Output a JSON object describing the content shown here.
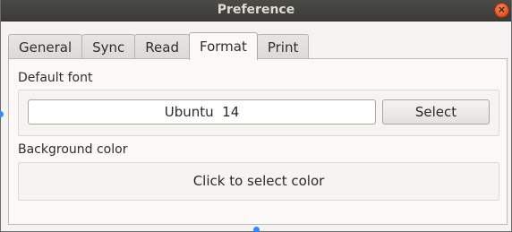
{
  "window": {
    "title": "Preference",
    "close_glyph": "×"
  },
  "tabs": [
    {
      "label": "General",
      "active": false
    },
    {
      "label": "Sync",
      "active": false
    },
    {
      "label": "Read",
      "active": false
    },
    {
      "label": "Format",
      "active": true
    },
    {
      "label": "Print",
      "active": false
    }
  ],
  "format": {
    "default_font_label": "Default font",
    "font_value": "Ubuntu  14",
    "select_button_label": "Select",
    "background_color_label": "Background color",
    "color_picker_text": "Click to select color"
  },
  "colors": {
    "accent_handle": "#2b8cff",
    "close_button": "#e1531f"
  }
}
